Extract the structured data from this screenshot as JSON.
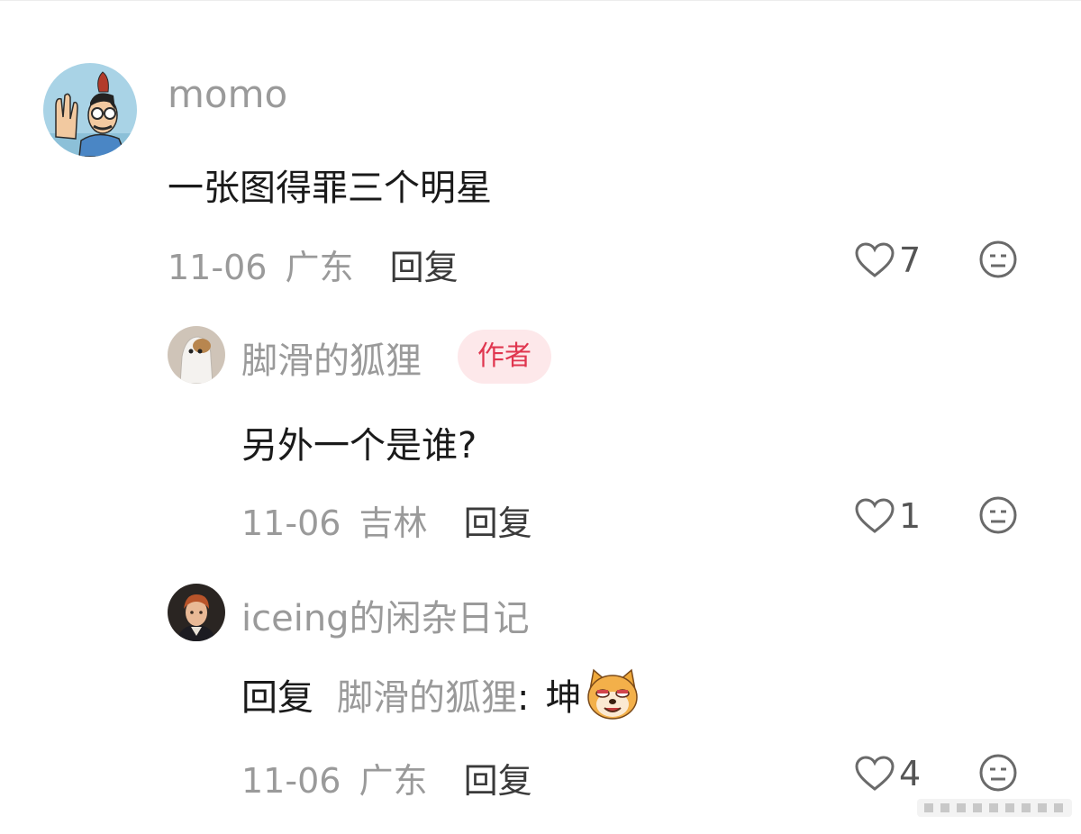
{
  "comments": [
    {
      "username": "momo",
      "text": "一张图得罪三个明星",
      "date": "11-06",
      "location": "广东",
      "reply_label": "回复",
      "likes": "7"
    },
    {
      "username": "脚滑的狐狸",
      "badge": "作者",
      "text": "另外一个是谁?",
      "date": "11-06",
      "location": "吉林",
      "reply_label": "回复",
      "likes": "1"
    },
    {
      "username": "iceing的闲杂日记",
      "reply_prefix": "回复",
      "reply_target": "脚滑的狐狸",
      "reply_colon": ":",
      "text": "坤",
      "date": "11-06",
      "location": "广东",
      "reply_label": "回复",
      "likes": "4"
    }
  ],
  "icons": {
    "like": "heart-outline-icon",
    "dislike": "neutral-face-icon",
    "sticker": "shiba-dog-emoji"
  },
  "colors": {
    "username": "#9a9a9a",
    "text": "#1a1a1a",
    "author_badge_bg": "#fde8ea",
    "author_badge_text": "#e0364f"
  }
}
